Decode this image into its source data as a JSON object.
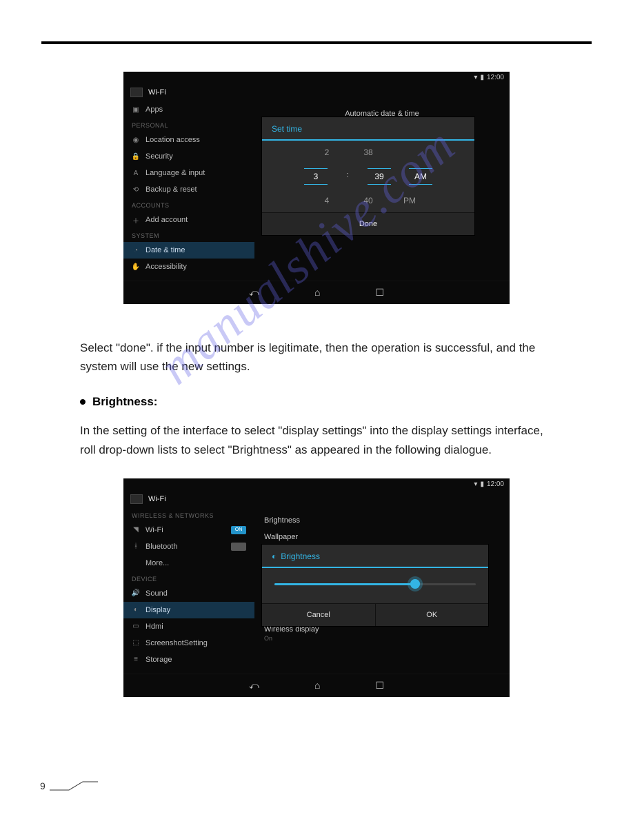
{
  "page_number": "9",
  "watermark": "manualshive.com",
  "body": {
    "para1": "Select \"done\". if the input number is legitimate, then the operation is successful, and the system will use the new settings.",
    "bullet_label": "Brightness:",
    "para2": "In the setting of the interface to select \"display settings\" into the display settings interface, roll drop-down lists to select \"Brightness\" as appeared in the following dialogue."
  },
  "shot1": {
    "status_time": "12:00",
    "wifi_label": "Wi-Fi",
    "sidebar": {
      "apps": "Apps",
      "personal": "PERSONAL",
      "location": "Location access",
      "security": "Security",
      "language": "Language & input",
      "backup": "Backup & reset",
      "accounts": "ACCOUNTS",
      "add_account": "Add account",
      "system": "SYSTEM",
      "datetime": "Date & time",
      "accessibility": "Accessibility"
    },
    "content_header": "Automatic date & time",
    "dialog": {
      "title": "Set time",
      "h_prev": "2",
      "h_sel": "3",
      "h_next": "4",
      "m_prev": "38",
      "m_sel": "39",
      "m_next": "40",
      "ap_sel": "AM",
      "ap_next": "PM",
      "done": "Done"
    }
  },
  "shot2": {
    "status_time": "12:00",
    "wifi_label": "Wi-Fi",
    "sidebar": {
      "wn": "WIRELESS & NETWORKS",
      "wifi": "Wi-Fi",
      "bt": "Bluetooth",
      "more": "More...",
      "device": "DEVICE",
      "sound": "Sound",
      "display": "Display",
      "hdmi": "Hdmi",
      "screenshot": "ScreenshotSetting",
      "storage": "Storage",
      "on": "ON"
    },
    "content": {
      "brightness": "Brightness",
      "wallpaper": "Wallpaper",
      "wireless_display": "Wireless display",
      "wd_sub": "On"
    },
    "dialog": {
      "title": "Brightness",
      "cancel": "Cancel",
      "ok": "OK"
    }
  }
}
